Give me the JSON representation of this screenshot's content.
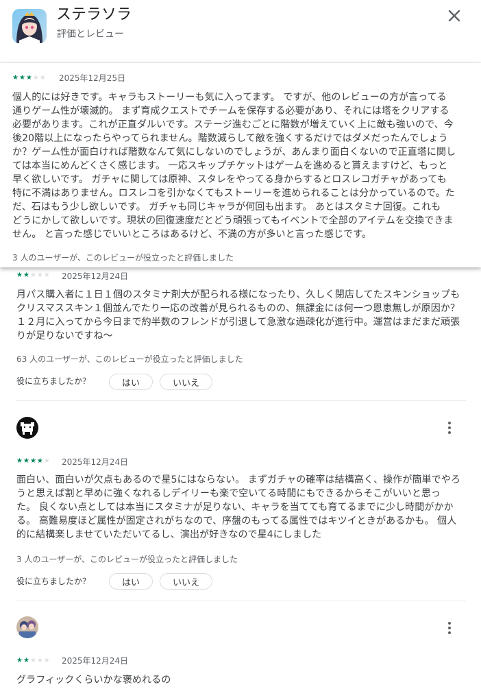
{
  "header": {
    "app_name": "ステラソラ",
    "subtitle": "評価とレビュー"
  },
  "reviews": [
    {
      "rating": 3,
      "date": "2025年12月25日",
      "lines": [
        "個人的には好きです。キャラもストーリーも気に入ってます。 ですが、他のレビューの方が言ってる",
        "通りゲーム性が壊滅的。 まず育成クエストでチームを保存する必要があり、それには塔をクリアする",
        "必要があります。これが正直ダルいです。ステージ進むごとに階数が増えていく上に敵も強いので、今",
        "後20階以上になったらやってられません。階数減らして敵を強くするだけではダメだったんでしょう",
        "か？ゲーム性が面白ければ階数なんて気にしないのでしょうが、あんまり面白くないので正直塔に関し",
        "ては本当にめんどくさく感じます。 一応スキップチケットはゲームを進めると貰えますけど、もっと",
        "早く欲しいです。 ガチャに関しては原神、スタレをやってる身からするとロスレコガチャがあっても",
        "特に不満はありません。ロスレコを引かなくてもストーリーを進められることは分かっているので。た",
        "だ、石はもう少し欲しいです。 ガチャも同じキャラが何回も出ます。 あとはスタミナ回復。これも",
        "どうにかして欲しいです。現状の回復速度だとどう頑張ってもイベントで全部のアイテムを交換できま",
        "せん。 と言った感じでいいところはあるけど、不満の方が多いと言った感じです。"
      ],
      "helpful": "3 人のユーザーが、このレビューが役立ったと評価しました"
    },
    {
      "rating": 2,
      "date": "2025年12月24日",
      "lines": [
        "月パス購入者に１日１個のスタミナ剤大が配られる様になったり、久しく閉店してたスキンショップも",
        "クリスマススキン１個並んでたり一応の改善が見られるものの、無課金には何一つ恩恵無しが原因か？",
        "１２月に入ってから今日まで約半数のフレンドが引退して急激な過疎化が進行中。運営はまだまだ頑張",
        "りが足りないですね〜"
      ],
      "helpful": "63 人のユーザーが、このレビューが役立ったと評価しました",
      "ask": "役に立ちましたか？",
      "yes": "はい",
      "no": "いいえ"
    },
    {
      "rating": 4,
      "date": "2025年12月24日",
      "lines": [
        "面白い、面白いが欠点もあるので星5にはならない。 まずガチャの確率は結構高く、操作が簡単でやろ",
        "うと思えば割と早めに強くなれるしデイリーも楽で空いてる時間にもできるからそこがいいと思っ",
        "た。 良くない点としては本当にスタミナが足りない、キャラを当てても育てるまでに少し時間がかか",
        "る。 高難易度ほど属性が固定されがちなので、序盤のもってる属性ではキツイときがあるかも。 個人",
        "的に結構楽しませていただいてるし、演出が好きなので星4にしました"
      ],
      "helpful": "3 人のユーザーが、このレビューが役立ったと評価しました",
      "ask": "役に立ちましたか？",
      "yes": "はい",
      "no": "いいえ"
    },
    {
      "rating": 2,
      "date": "2025年12月24日",
      "lines": [
        "グラフィックくらいかな褒めれるの"
      ]
    }
  ],
  "icons": {
    "close": "close-icon",
    "more": "more-vert-icon",
    "star": "star-icon"
  },
  "colors": {
    "star_on": "#01875f",
    "star_off": "#e0e0e0",
    "text": "#3c4043",
    "muted": "#5f6368"
  }
}
